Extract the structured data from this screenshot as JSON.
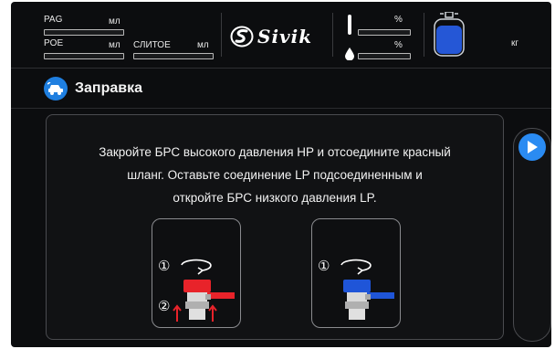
{
  "status": {
    "pag_label": "PAG",
    "pag_unit": "мл",
    "poe_label": "POE",
    "poe_unit": "мл",
    "clitoe_label": "СЛИТОЕ",
    "clitoe_unit": "мл",
    "logo_text": "Sivik",
    "level1_unit": "%",
    "level2_unit": "%",
    "tank_unit": "кг"
  },
  "header": {
    "title": "Заправка",
    "icon": "car-icon"
  },
  "instruction": {
    "line1": "Закройте БРС высокого давления HP и отсоедините красный",
    "line2": "шланг. Оставьте соединение LP подсоединенным и",
    "line3": "откройте БРС низкого давления LP."
  },
  "steps": {
    "hp": {
      "step1": "①",
      "step2": "②"
    },
    "lp": {
      "step1": "①"
    }
  },
  "colors": {
    "hp_valve": "#e8232a",
    "lp_valve": "#1f55d8",
    "accent": "#2a8bf2"
  },
  "next_button": {
    "icon": "play-icon"
  }
}
